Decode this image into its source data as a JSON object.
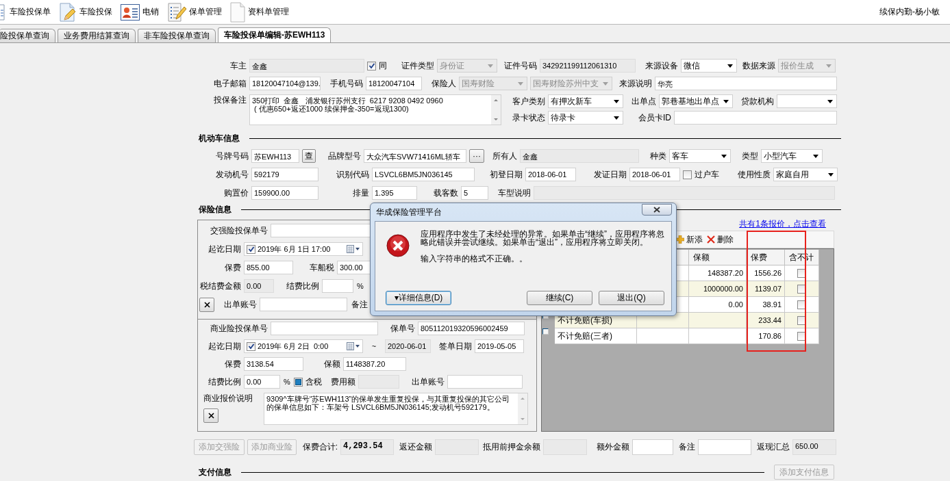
{
  "toolbar": {
    "items": [
      {
        "label": "车险投保单"
      },
      {
        "label": "车险投保"
      },
      {
        "label": "电销"
      },
      {
        "label": "保单管理"
      },
      {
        "label": "资料单管理"
      }
    ],
    "user": "续保内勤-杨小敏"
  },
  "tabs": [
    {
      "label": "险投保单查询",
      "selected": false
    },
    {
      "label": "业务费用结算查询",
      "selected": false
    },
    {
      "label": "非车险投保单查询",
      "selected": false
    },
    {
      "label": "车险投保单编辑-苏EWH113",
      "selected": true
    }
  ],
  "owner_rows": [
    [
      {
        "kind": "label",
        "text": "车主"
      },
      {
        "kind": "text",
        "value": "金鑫",
        "disabled": true
      },
      {
        "kind": "check",
        "label": "同",
        "checked": true
      },
      {
        "kind": "label",
        "text": "证件类型"
      },
      {
        "kind": "select",
        "value": "身份证",
        "disabled": true
      },
      {
        "kind": "label",
        "text": "证件号码"
      },
      {
        "kind": "text",
        "value": "342921199112061310",
        "disabled": true
      },
      {
        "kind": "label",
        "text": "来源设备"
      },
      {
        "kind": "select",
        "value": "微信",
        "disabled": false
      },
      {
        "kind": "label",
        "text": "数据来源"
      },
      {
        "kind": "select",
        "value": "报价生成",
        "disabled": true
      }
    ],
    [
      {
        "kind": "label",
        "text": "电子邮箱"
      },
      {
        "kind": "text",
        "value": "18120047104@139.",
        "disabled": false
      },
      {
        "kind": "label",
        "text": "手机号码"
      },
      {
        "kind": "text",
        "value": "18120047104",
        "disabled": false
      },
      {
        "kind": "label",
        "text": "保险人"
      },
      {
        "kind": "select",
        "value": "国寿财险",
        "disabled": true
      },
      {
        "kind": "select",
        "value": "国寿财险苏州中支",
        "disabled": true
      },
      {
        "kind": "label",
        "text": "来源说明"
      },
      {
        "kind": "text",
        "value": "华亮",
        "disabled": false
      }
    ]
  ],
  "remarks": {
    "label": "投保备注",
    "value": "350打印  金鑫   浦发银行苏州支行  6217 9208 0492 0960\n ( 优惠650+返还1000 续保押金-350=返现1300)"
  },
  "remarks_side_rows": [
    [
      {
        "kind": "label",
        "text": "客户类别"
      },
      {
        "kind": "select",
        "value": "有押次新车",
        "disabled": false
      },
      {
        "kind": "label",
        "text": "出单点"
      },
      {
        "kind": "select",
        "value": "郭巷基地出单点",
        "disabled": false
      },
      {
        "kind": "label",
        "text": "贷款机构"
      },
      {
        "kind": "select",
        "disabled": false
      }
    ],
    [
      {
        "kind": "label",
        "text": "录卡状态"
      },
      {
        "kind": "select",
        "value": "待录卡",
        "disabled": false
      },
      {
        "kind": "label",
        "text": "会员卡ID"
      },
      {
        "kind": "text",
        "disabled": false
      }
    ]
  ],
  "vehicle": {
    "title": "机动车信息",
    "rows": [
      {
        "fields": [
          {
            "kind": "label",
            "text": "号牌号码"
          },
          {
            "kind": "text",
            "value": "苏EWH113",
            "disabled": false
          },
          {
            "kind": "button",
            "text": "查"
          },
          {
            "kind": "label",
            "text": "品牌型号"
          },
          {
            "kind": "text",
            "value": "大众汽车SVW71416ML轿车",
            "disabled": false
          },
          {
            "kind": "button",
            "text": "···"
          },
          {
            "kind": "label",
            "text": "所有人"
          },
          {
            "kind": "text",
            "value": "金鑫",
            "disabled": true
          },
          {
            "kind": "label",
            "text": "种类"
          },
          {
            "kind": "select",
            "value": "客车",
            "disabled": false
          },
          {
            "kind": "label",
            "text": "类型"
          },
          {
            "kind": "select",
            "value": "小型汽车",
            "disabled": false
          }
        ]
      },
      {
        "fields": [
          {
            "kind": "label",
            "text": "发动机号"
          },
          {
            "kind": "text",
            "value": "592179",
            "disabled": false
          },
          {
            "kind": "label",
            "text": "识别代码"
          },
          {
            "kind": "text",
            "value": "LSVCL6BM5JN036145",
            "disabled": false
          },
          {
            "kind": "label",
            "text": "初登日期"
          },
          {
            "kind": "text",
            "value": "2018-06-01",
            "disabled": false
          },
          {
            "kind": "label",
            "text": "发证日期"
          },
          {
            "kind": "text",
            "value": "2018-06-01",
            "disabled": false
          },
          {
            "kind": "check",
            "label": "过户车",
            "checked": false
          },
          {
            "kind": "label",
            "text": "使用性质"
          },
          {
            "kind": "select",
            "value": "家庭自用",
            "disabled": false
          }
        ]
      },
      {
        "fields": [
          {
            "kind": "label",
            "text": "购置价"
          },
          {
            "kind": "text",
            "value": "159900.00",
            "disabled": false
          },
          {
            "kind": "label",
            "text": "排量"
          },
          {
            "kind": "text",
            "value": "1.395",
            "disabled": false
          },
          {
            "kind": "label",
            "text": "载客数"
          },
          {
            "kind": "text",
            "value": "5",
            "disabled": false
          },
          {
            "kind": "label",
            "text": "车型说明"
          },
          {
            "kind": "text",
            "disabled": true
          }
        ]
      }
    ]
  },
  "insurance": {
    "title": "保险信息",
    "compulsory_rows": [
      [
        {
          "kind": "label",
          "text": "交强险投保单号"
        },
        {
          "kind": "text",
          "disabled": false
        }
      ],
      [
        {
          "kind": "label",
          "text": "起讫日期"
        },
        {
          "kind": "datetime",
          "value": "2019年 6月 1日 17:00",
          "checked": true
        }
      ],
      [
        {
          "kind": "label",
          "text": "保费"
        },
        {
          "kind": "text",
          "value": "855.00",
          "disabled": false
        },
        {
          "kind": "label",
          "text": "车船税"
        },
        {
          "kind": "text",
          "value": "300.00",
          "disabled": false
        }
      ],
      [
        {
          "kind": "label",
          "text": "税结费金额"
        },
        {
          "kind": "text",
          "value": "0.00",
          "disabled": true
        },
        {
          "kind": "label",
          "text": "结费比例"
        },
        {
          "kind": "text",
          "disabled": false
        },
        {
          "kind": "static",
          "text": "%"
        }
      ],
      [
        {
          "kind": "remove"
        },
        {
          "kind": "label",
          "text": "出单账号"
        },
        {
          "kind": "text",
          "disabled": false
        },
        {
          "kind": "label",
          "text": "备注"
        }
      ]
    ],
    "commercial_rows": [
      [
        {
          "kind": "label",
          "text": "商业险投保单号"
        },
        {
          "kind": "text",
          "disabled": false
        },
        {
          "kind": "label",
          "text": "保单号"
        },
        {
          "kind": "text",
          "value": "805112019320596002459",
          "disabled": false
        }
      ],
      [
        {
          "kind": "label",
          "text": "起讫日期"
        },
        {
          "kind": "datetime",
          "value": "2019年 6月 2日  0:00",
          "checked": true
        },
        {
          "kind": "static",
          "text": "~"
        },
        {
          "kind": "text",
          "value": "2020-06-01",
          "disabled": true
        },
        {
          "kind": "label",
          "text": "签单日期"
        },
        {
          "kind": "text",
          "value": "2019-05-05",
          "disabled": false
        }
      ],
      [
        {
          "kind": "label",
          "text": "保费"
        },
        {
          "kind": "text",
          "value": "3138.54",
          "disabled": false
        },
        {
          "kind": "label",
          "text": "保额"
        },
        {
          "kind": "text",
          "value": "1148387.20",
          "disabled": false
        }
      ],
      [
        {
          "kind": "label",
          "text": "结费比例"
        },
        {
          "kind": "text",
          "value": "0.00",
          "disabled": false
        },
        {
          "kind": "static",
          "text": "%"
        },
        {
          "kind": "square_check",
          "label": "含税",
          "checked": true
        },
        {
          "kind": "label",
          "text": "费用额"
        },
        {
          "kind": "text",
          "disabled": true
        },
        {
          "kind": "label",
          "text": "出单账号"
        },
        {
          "kind": "text",
          "disabled": false
        }
      ]
    ],
    "quote_note": {
      "label": "商业报价说明",
      "value": "9309^车牌号“苏EWH113”的保单发生重复投保，与其重复投保的其它公司的保单信息如下：车架号 LSVCL6BM5JN036145;发动机号592179。"
    },
    "quote_link": "共有1条报价，点击查看",
    "grid_toolbar": [
      {
        "kind": "add",
        "label": "新添"
      },
      {
        "kind": "delete",
        "label": "删除"
      }
    ],
    "grid": {
      "columns": [
        "保额",
        "保费",
        "含不计"
      ],
      "rows": [
        {
          "sum_insured": "148387.20",
          "premium": "1556.26",
          "non_deductible": false
        },
        {
          "sum_insured": "1000000.00",
          "premium": "1139.07",
          "non_deductible": false
        },
        {
          "sum_insured": "0.00",
          "premium": "38.91",
          "non_deductible": false
        },
        {
          "name": "不计免赔(车损)",
          "premium": "233.44",
          "non_deductible": false
        },
        {
          "name": "不计免赔(三者)",
          "premium": "170.86",
          "non_deductible": false
        }
      ]
    }
  },
  "totals": [
    {
      "kind": "button",
      "text": "添加交强险",
      "disabled": true
    },
    {
      "kind": "button",
      "text": "添加商业险",
      "disabled": true
    },
    {
      "kind": "label",
      "text": "保费合计:"
    },
    {
      "kind": "amount",
      "value": "4,293.54"
    },
    {
      "kind": "label",
      "text": "返还金额"
    },
    {
      "kind": "text",
      "disabled": true
    },
    {
      "kind": "label",
      "text": "抵用前押金余额"
    },
    {
      "kind": "text",
      "disabled": true
    },
    {
      "kind": "label",
      "text": "额外金额"
    },
    {
      "kind": "text",
      "disabled": false
    },
    {
      "kind": "label",
      "text": "备注"
    },
    {
      "kind": "text",
      "disabled": false
    },
    {
      "kind": "label",
      "text": "返现汇总"
    },
    {
      "kind": "text",
      "value": "650.00",
      "disabled": true
    }
  ],
  "payment": {
    "title": "支付信息",
    "button": "添加支付信息",
    "button_disabled": true
  },
  "dialog": {
    "title": "华成保险管理平台",
    "message": "应用程序中发生了未经处理的异常。如果单击“继续”，应用程序将忽略此错误并尝试继续。如果单击“退出”，应用程序将立即关闭。",
    "detail": "输入字符串的格式不正确。。",
    "details_button": "▾详细信息(D)",
    "buttons": [
      "继续(C)",
      "退出(Q)"
    ]
  }
}
